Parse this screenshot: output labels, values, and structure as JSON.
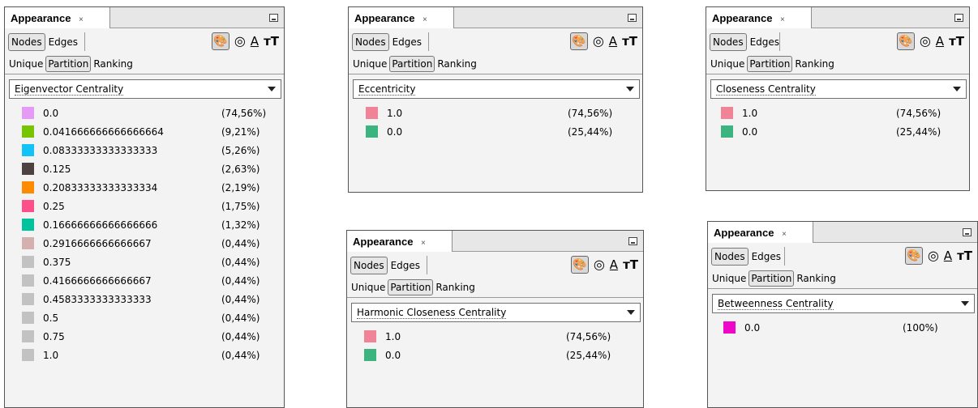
{
  "panels": [
    {
      "title": "Appearance",
      "close_glyph": "×",
      "tabs": [
        "Nodes",
        "Edges"
      ],
      "types": [
        "Unique",
        "Partition",
        "Ranking"
      ],
      "dropdown": "Eigenvector Centrality",
      "icons": [
        "palette-icon",
        "size-icon",
        "label-color-icon",
        "label-size-icon"
      ],
      "items": [
        {
          "value": "0.0",
          "percent": "(74,56%)",
          "color": "#e59af5"
        },
        {
          "value": "0.041666666666666664",
          "percent": "(9,21%)",
          "color": "#77c500"
        },
        {
          "value": "0.08333333333333333",
          "percent": "(5,26%)",
          "color": "#13c3f8"
        },
        {
          "value": "0.125",
          "percent": "(2,63%)",
          "color": "#4d4142"
        },
        {
          "value": "0.20833333333333334",
          "percent": "(2,19%)",
          "color": "#fe8a00"
        },
        {
          "value": "0.25",
          "percent": "(1,75%)",
          "color": "#fe4f8a"
        },
        {
          "value": "0.16666666666666666",
          "percent": "(1,32%)",
          "color": "#00c29d"
        },
        {
          "value": "0.2916666666666667",
          "percent": "(0,44%)",
          "color": "#d4b1ae"
        },
        {
          "value": "0.375",
          "percent": "(0,44%)",
          "color": "#c2c2c2"
        },
        {
          "value": "0.4166666666666667",
          "percent": "(0,44%)",
          "color": "#c2c2c2"
        },
        {
          "value": "0.4583333333333333",
          "percent": "(0,44%)",
          "color": "#c2c2c2"
        },
        {
          "value": "0.5",
          "percent": "(0,44%)",
          "color": "#c2c2c2"
        },
        {
          "value": "0.75",
          "percent": "(0,44%)",
          "color": "#c2c2c2"
        },
        {
          "value": "1.0",
          "percent": "(0,44%)",
          "color": "#c2c2c2"
        }
      ]
    },
    {
      "title": "Appearance",
      "close_glyph": "×",
      "tabs": [
        "Nodes",
        "Edges"
      ],
      "types": [
        "Unique",
        "Partition",
        "Ranking"
      ],
      "dropdown": "Eccentricity",
      "icons": [
        "palette-icon",
        "size-icon",
        "label-color-icon",
        "label-size-icon"
      ],
      "items": [
        {
          "value": "1.0",
          "percent": "(74,56%)",
          "color": "#f08496"
        },
        {
          "value": "0.0",
          "percent": "(25,44%)",
          "color": "#3cb47f"
        }
      ]
    },
    {
      "title": "Appearance",
      "close_glyph": "×",
      "tabs": [
        "Nodes",
        "Edges"
      ],
      "types": [
        "Unique",
        "Partition",
        "Ranking"
      ],
      "dropdown": "Closeness Centrality",
      "icons": [
        "palette-icon",
        "size-icon",
        "label-color-icon",
        "label-size-icon"
      ],
      "items": [
        {
          "value": "1.0",
          "percent": "(74,56%)",
          "color": "#f08496"
        },
        {
          "value": "0.0",
          "percent": "(25,44%)",
          "color": "#3cb47f"
        }
      ]
    },
    {
      "title": "Appearance",
      "close_glyph": "×",
      "tabs": [
        "Nodes",
        "Edges"
      ],
      "types": [
        "Unique",
        "Partition",
        "Ranking"
      ],
      "dropdown": "Harmonic Closeness Centrality",
      "icons": [
        "palette-icon",
        "size-icon",
        "label-color-icon",
        "label-size-icon"
      ],
      "items": [
        {
          "value": "1.0",
          "percent": "(74,56%)",
          "color": "#f08496"
        },
        {
          "value": "0.0",
          "percent": "(25,44%)",
          "color": "#3cb47f"
        }
      ]
    },
    {
      "title": "Appearance",
      "close_glyph": "×",
      "tabs": [
        "Nodes",
        "Edges"
      ],
      "types": [
        "Unique",
        "Partition",
        "Ranking"
      ],
      "dropdown": "Betweenness Centrality",
      "icons": [
        "palette-icon",
        "size-icon",
        "label-color-icon",
        "label-size-icon"
      ],
      "items": [
        {
          "value": "0.0",
          "percent": "(100%)",
          "color": "#ee07c9"
        }
      ]
    }
  ]
}
